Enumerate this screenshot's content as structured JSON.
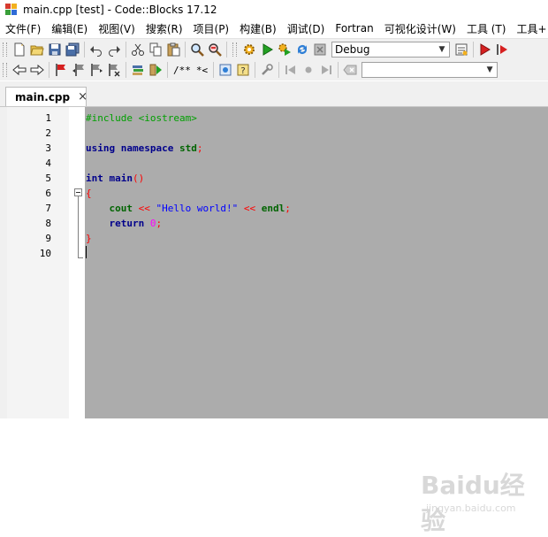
{
  "window": {
    "title": "main.cpp [test] - Code::Blocks 17.12"
  },
  "menu": {
    "items": [
      "文件(F)",
      "编辑(E)",
      "视图(V)",
      "搜索(R)",
      "项目(P)",
      "构建(B)",
      "调试(D)",
      "Fortran",
      "可视化设计(W)",
      "工具 (T)",
      "工具+"
    ]
  },
  "toolbar": {
    "build_target": "Debug",
    "doxy_block_comment": "/**",
    "doxy_line_comment": "*<",
    "search_value": ""
  },
  "editor": {
    "tab_label": "main.cpp",
    "tab_close": "×",
    "line_numbers": [
      "1",
      "2",
      "3",
      "4",
      "5",
      "6",
      "7",
      "8",
      "9",
      "10"
    ],
    "code_lines": [
      [
        {
          "t": "#include <iostream>",
          "c": "pp"
        }
      ],
      [],
      [
        {
          "t": "using",
          "c": "kw"
        },
        {
          "t": " ",
          "c": ""
        },
        {
          "t": "namespace",
          "c": "kw"
        },
        {
          "t": " ",
          "c": ""
        },
        {
          "t": "std",
          "c": "id"
        },
        {
          "t": ";",
          "c": "op"
        }
      ],
      [],
      [
        {
          "t": "int",
          "c": "kw"
        },
        {
          "t": " ",
          "c": ""
        },
        {
          "t": "main",
          "c": "kw"
        },
        {
          "t": "()",
          "c": "op"
        }
      ],
      [
        {
          "t": "{",
          "c": "op"
        }
      ],
      [
        {
          "t": "    ",
          "c": ""
        },
        {
          "t": "cout",
          "c": "id"
        },
        {
          "t": " ",
          "c": ""
        },
        {
          "t": "<<",
          "c": "op"
        },
        {
          "t": " ",
          "c": ""
        },
        {
          "t": "\"Hello world!\"",
          "c": "str"
        },
        {
          "t": " ",
          "c": ""
        },
        {
          "t": "<<",
          "c": "op"
        },
        {
          "t": " ",
          "c": ""
        },
        {
          "t": "endl",
          "c": "id"
        },
        {
          "t": ";",
          "c": "op"
        }
      ],
      [
        {
          "t": "    ",
          "c": ""
        },
        {
          "t": "return",
          "c": "kw"
        },
        {
          "t": " ",
          "c": ""
        },
        {
          "t": "0",
          "c": "num"
        },
        {
          "t": ";",
          "c": "op"
        }
      ],
      [
        {
          "t": "}",
          "c": "op"
        }
      ],
      []
    ]
  },
  "watermark": {
    "brand": "Baidu经验",
    "url": "jingyan.baidu.com"
  },
  "colors": {
    "code_background": "#acacac",
    "preprocessor": "#00a000",
    "keyword": "#00008b",
    "operator": "#ff0000",
    "string": "#0000ff",
    "number": "#ff00ff"
  }
}
